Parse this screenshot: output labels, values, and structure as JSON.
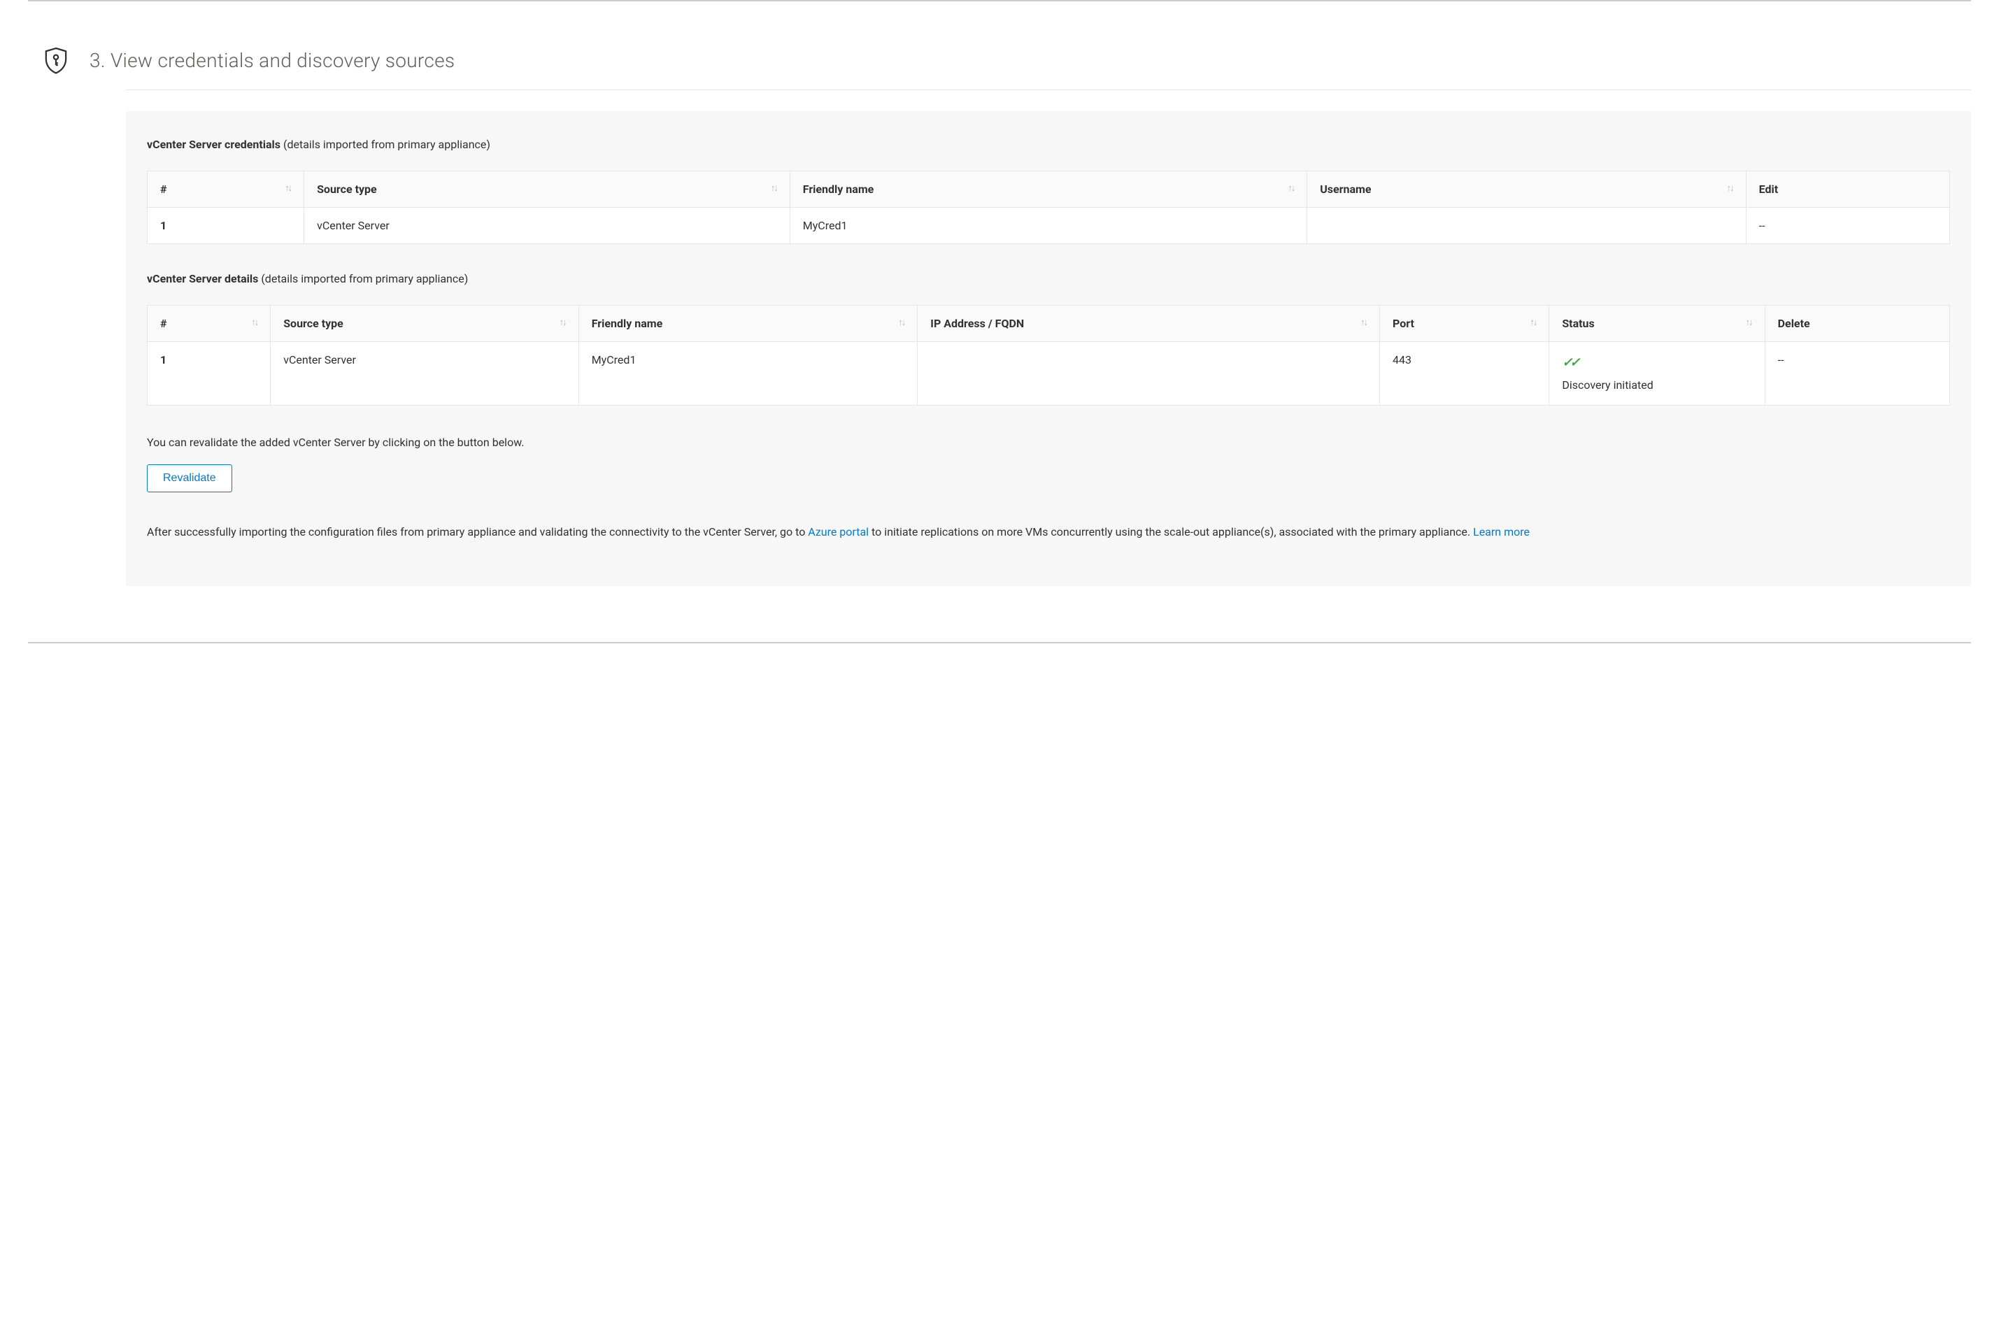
{
  "section": {
    "title": "3. View credentials and discovery sources"
  },
  "credentials": {
    "heading_bold": "vCenter Server credentials",
    "heading_note": " (details imported from primary appliance)",
    "columns": {
      "num": "#",
      "source_type": "Source type",
      "friendly_name": "Friendly name",
      "username": "Username",
      "edit": "Edit"
    },
    "rows": [
      {
        "num": "1",
        "source_type": "vCenter Server",
        "friendly_name": "MyCred1",
        "username": "",
        "edit": "--"
      }
    ]
  },
  "details": {
    "heading_bold": "vCenter Server details",
    "heading_note": " (details imported from primary appliance)",
    "columns": {
      "num": "#",
      "source_type": "Source type",
      "friendly_name": "Friendly name",
      "ip": "IP Address / FQDN",
      "port": "Port",
      "status": "Status",
      "delete": "Delete"
    },
    "rows": [
      {
        "num": "1",
        "source_type": "vCenter Server",
        "friendly_name": "MyCred1",
        "ip": "",
        "port": "443",
        "status_text": "Discovery initiated",
        "delete": "--"
      }
    ]
  },
  "revalidate": {
    "text": "You can revalidate the added vCenter Server by clicking on the button below.",
    "button": "Revalidate"
  },
  "footer_text": {
    "part1": "After successfully importing the configuration files from primary appliance and validating the connectivity to the vCenter Server, go to ",
    "link1": "Azure portal",
    "part2": " to initiate replications on more VMs concurrently using the scale-out appliance(s), associated with the primary appliance. ",
    "link2": "Learn more"
  }
}
